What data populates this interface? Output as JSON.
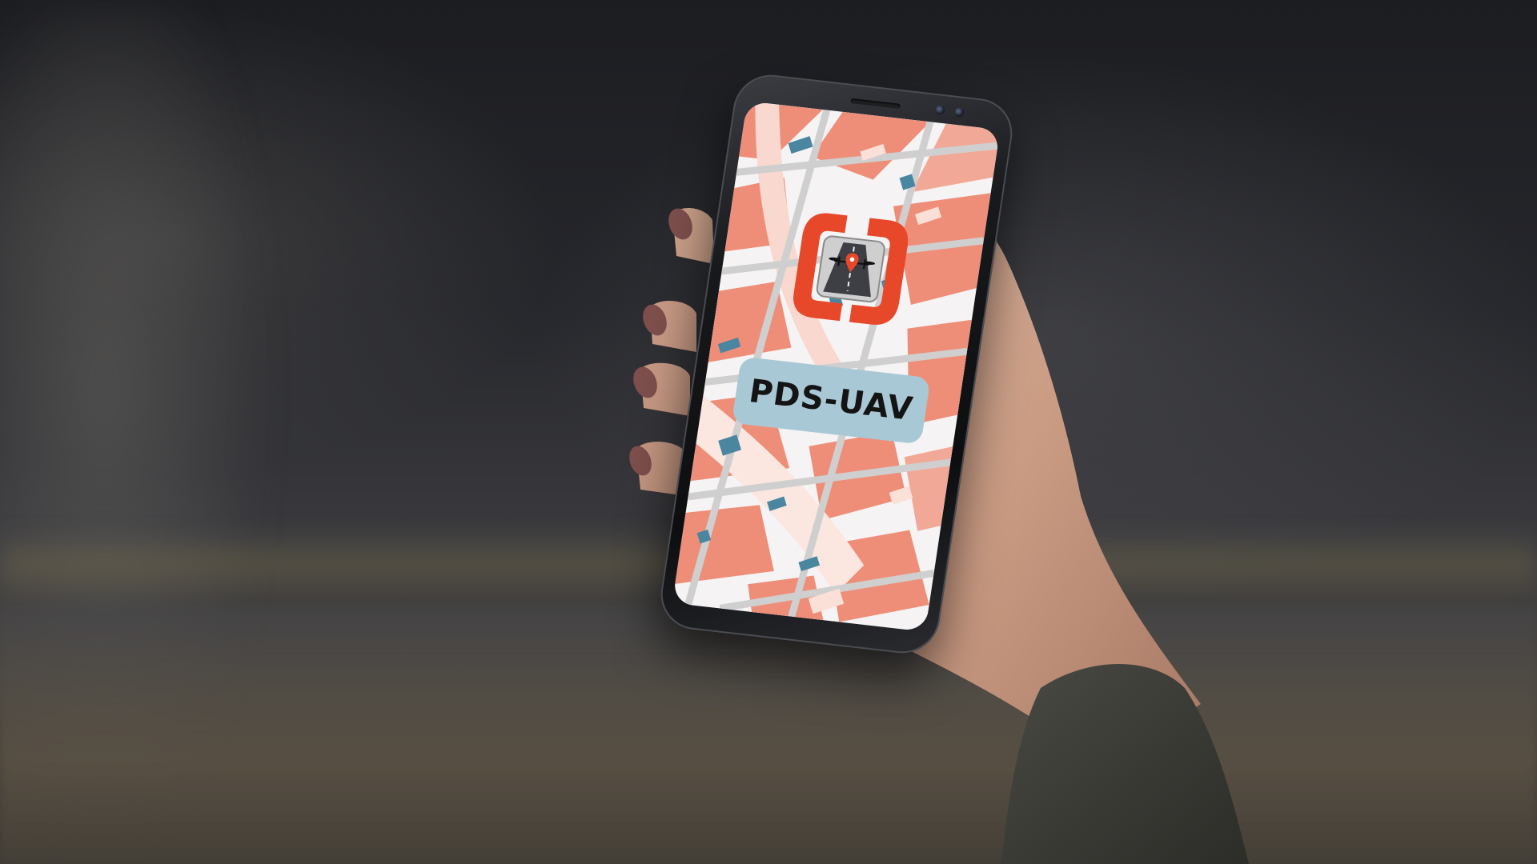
{
  "app": {
    "name": "PDS-UAV",
    "icon": "drone-map-pin-icon"
  },
  "colors": {
    "brand_orange": "#e8482a",
    "map_salmon": "#ef8e78",
    "map_road": "#cfcfcf",
    "map_blue": "#4a86a0",
    "title_badge": "#a9c8d6"
  }
}
